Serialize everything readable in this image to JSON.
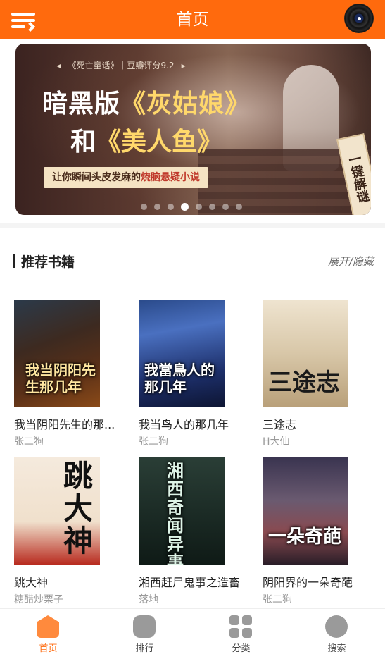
{
  "header": {
    "title": "首页",
    "menu_icon": "menu-icon",
    "avatar_icon": "vinyl-avatar-icon"
  },
  "banner": {
    "subtitle_book": "《死亡童话》",
    "subtitle_score": "豆瓣评分9.2",
    "line1_pre": "暗黑版",
    "line1_hl": "《灰姑娘》",
    "line2_pre": "和",
    "line2_hl": "《美人鱼》",
    "tag_pre": "让你瞬间头皮发麻的",
    "tag_hl": "烧脑悬疑小说",
    "badge": "一键解谜",
    "dots_count": 8,
    "active_dot": 3
  },
  "section": {
    "title": "推荐书籍",
    "toggle": "展开/隐藏"
  },
  "books": [
    {
      "title": "我当阴阳先生的那...",
      "author": "张二狗",
      "cover_text": "我当阴阳先生那几年"
    },
    {
      "title": "我当鸟人的那几年",
      "author": "张二狗",
      "cover_text": "我當鳥人的那几年"
    },
    {
      "title": "三途志",
      "author": "H大仙",
      "cover_text": "三途志"
    },
    {
      "title": "跳大神",
      "author": "糖醋炒栗子",
      "cover_text": "跳大神"
    },
    {
      "title": "湘西赶尸鬼事之造畜",
      "author": "落地",
      "cover_text": "湘西奇闻异事"
    },
    {
      "title": "阴阳界的一朵奇葩",
      "author": "张二狗",
      "cover_text": "一朵奇葩"
    }
  ],
  "tabs": [
    {
      "label": "首页",
      "icon": "home-icon",
      "active": true
    },
    {
      "label": "排行",
      "icon": "rank-icon",
      "active": false
    },
    {
      "label": "分类",
      "icon": "category-icon",
      "active": false
    },
    {
      "label": "搜索",
      "icon": "search-icon",
      "active": false
    }
  ],
  "colors": {
    "accent": "#ff6a0d",
    "background": "#f4f4f4",
    "muted_text": "#9a9a9a"
  }
}
